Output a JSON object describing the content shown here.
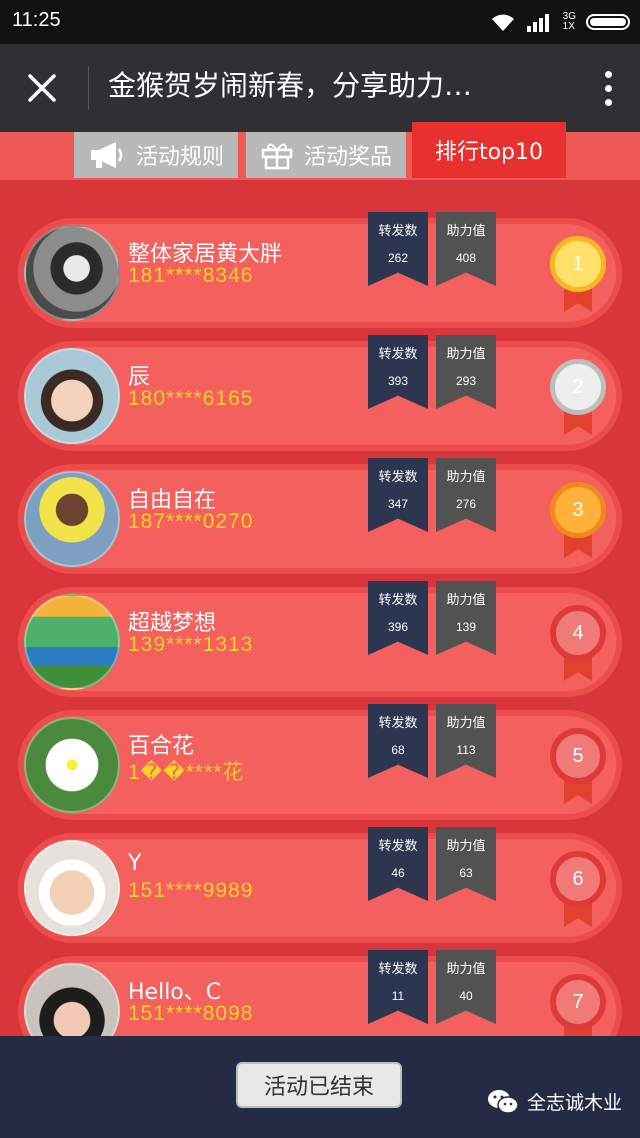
{
  "status_bar": {
    "time": "11:25",
    "network_top": "3G",
    "network_bottom": "1X",
    "icons": [
      "wifi-icon",
      "signal-icon",
      "battery-icon"
    ]
  },
  "header": {
    "title": "金猴贺岁闹新春，分享助力…",
    "close_icon": "close-icon",
    "more_icon": "more-vertical-icon"
  },
  "tabs": [
    {
      "label": "活动规则",
      "icon": "megaphone-icon"
    },
    {
      "label": "活动奖品",
      "icon": "gift-icon"
    },
    {
      "label": "排行top10",
      "icon": ""
    }
  ],
  "ribbon_labels": {
    "forward": "转发数",
    "help": "助力值"
  },
  "ranking": [
    {
      "rank": "1",
      "name": "整体家居黄大胖",
      "phone": "181****8346",
      "forward": "262",
      "help": "408",
      "medal": "gold"
    },
    {
      "rank": "2",
      "name": "辰",
      "phone": "180****6165",
      "forward": "393",
      "help": "293",
      "medal": "silver"
    },
    {
      "rank": "3",
      "name": "自由自在",
      "phone": "187****0270",
      "forward": "347",
      "help": "276",
      "medal": "bronze"
    },
    {
      "rank": "4",
      "name": "超越梦想",
      "phone": "139****1313",
      "forward": "396",
      "help": "139",
      "medal": "red"
    },
    {
      "rank": "5",
      "name": "百合花",
      "phone": "1��****花",
      "forward": "68",
      "help": "113",
      "medal": "red"
    },
    {
      "rank": "6",
      "name": "Y",
      "phone": "151****9989",
      "forward": "46",
      "help": "63",
      "medal": "red"
    },
    {
      "rank": "7",
      "name": "Hello、C",
      "phone": "151****8098",
      "forward": "11",
      "help": "40",
      "medal": "red"
    }
  ],
  "footer": {
    "end_button": "活动已结束",
    "brand": "全志诚木业",
    "brand_icon": "wechat-icon"
  },
  "colors": {
    "page_bg": "#d9363b",
    "row_bg": "#f4605e",
    "phone_text": "#ffd324",
    "forward_ribbon": "#2d3650",
    "help_ribbon": "#525252",
    "footer_bg": "#262b45"
  }
}
